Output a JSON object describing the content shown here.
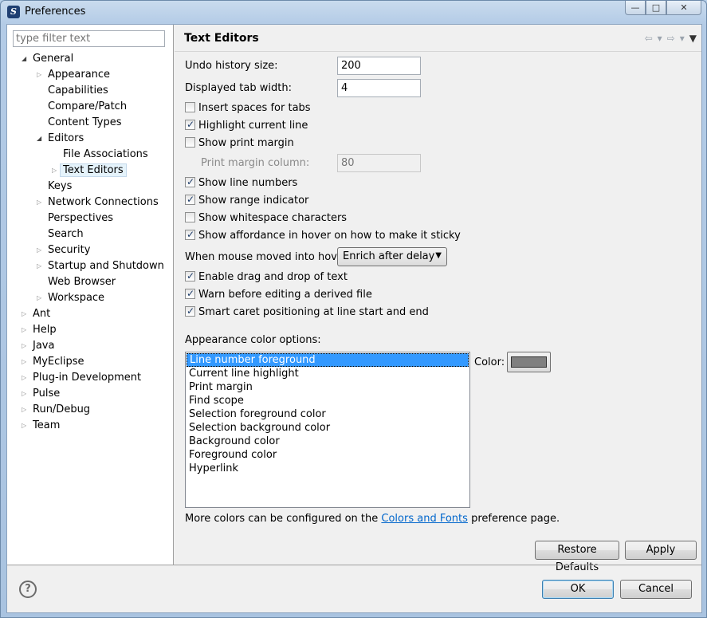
{
  "window": {
    "title": "Preferences",
    "controls": {
      "minimize": "—",
      "restore": "□",
      "close": "✕"
    }
  },
  "filter": {
    "placeholder": "type filter text"
  },
  "tree": {
    "general": "General",
    "appearance": "Appearance",
    "capabilities": "Capabilities",
    "compare_patch": "Compare/Patch",
    "content_types": "Content Types",
    "editors": "Editors",
    "file_associations": "File Associations",
    "text_editors": "Text Editors",
    "keys": "Keys",
    "network_connections": "Network Connections",
    "perspectives": "Perspectives",
    "search": "Search",
    "security": "Security",
    "startup_shutdown": "Startup and Shutdown",
    "web_browser": "Web Browser",
    "workspace": "Workspace",
    "ant": "Ant",
    "help": "Help",
    "java": "Java",
    "myeclipse": "MyEclipse",
    "plugin_dev": "Plug-in Development",
    "pulse": "Pulse",
    "run_debug": "Run/Debug",
    "team": "Team"
  },
  "page": {
    "title": "Text Editors",
    "undo_label": "Undo history size:",
    "undo_value": "200",
    "tab_width_label": "Displayed tab width:",
    "tab_width_value": "4",
    "insert_spaces": "Insert spaces for tabs",
    "highlight_line": "Highlight current line",
    "show_print_margin": "Show print margin",
    "print_margin_label": "Print margin column:",
    "print_margin_value": "80",
    "show_line_numbers": "Show line numbers",
    "show_range": "Show range indicator",
    "show_whitespace": "Show whitespace characters",
    "show_affordance": "Show affordance in hover on how to make it sticky",
    "hover_label": "When mouse moved into hover:",
    "hover_value": "Enrich after delay",
    "drag_drop": "Enable drag and drop of text",
    "warn_derived": "Warn before editing a derived file",
    "smart_caret": "Smart caret positioning at line start and end",
    "appearance_label": "Appearance color options:",
    "color_label": "Color:",
    "color_value": "#808080",
    "color_options": [
      "Line number foreground",
      "Current line highlight",
      "Print margin",
      "Find scope",
      "Selection foreground color",
      "Selection background color",
      "Background color",
      "Foreground color",
      "Hyperlink"
    ],
    "more_colors_prefix": "More colors can be configured on the",
    "more_colors_link": "Colors and Fonts",
    "more_colors_suffix": "preference page.",
    "restore_defaults": "Restore Defaults",
    "apply": "Apply"
  },
  "checks": {
    "insert_spaces": false,
    "highlight_line": true,
    "show_print_margin": false,
    "show_line_numbers": true,
    "show_range": true,
    "show_whitespace": false,
    "show_affordance": true,
    "drag_drop": true,
    "warn_derived": true,
    "smart_caret": true
  },
  "footer": {
    "help": "?",
    "ok": "OK",
    "cancel": "Cancel"
  }
}
